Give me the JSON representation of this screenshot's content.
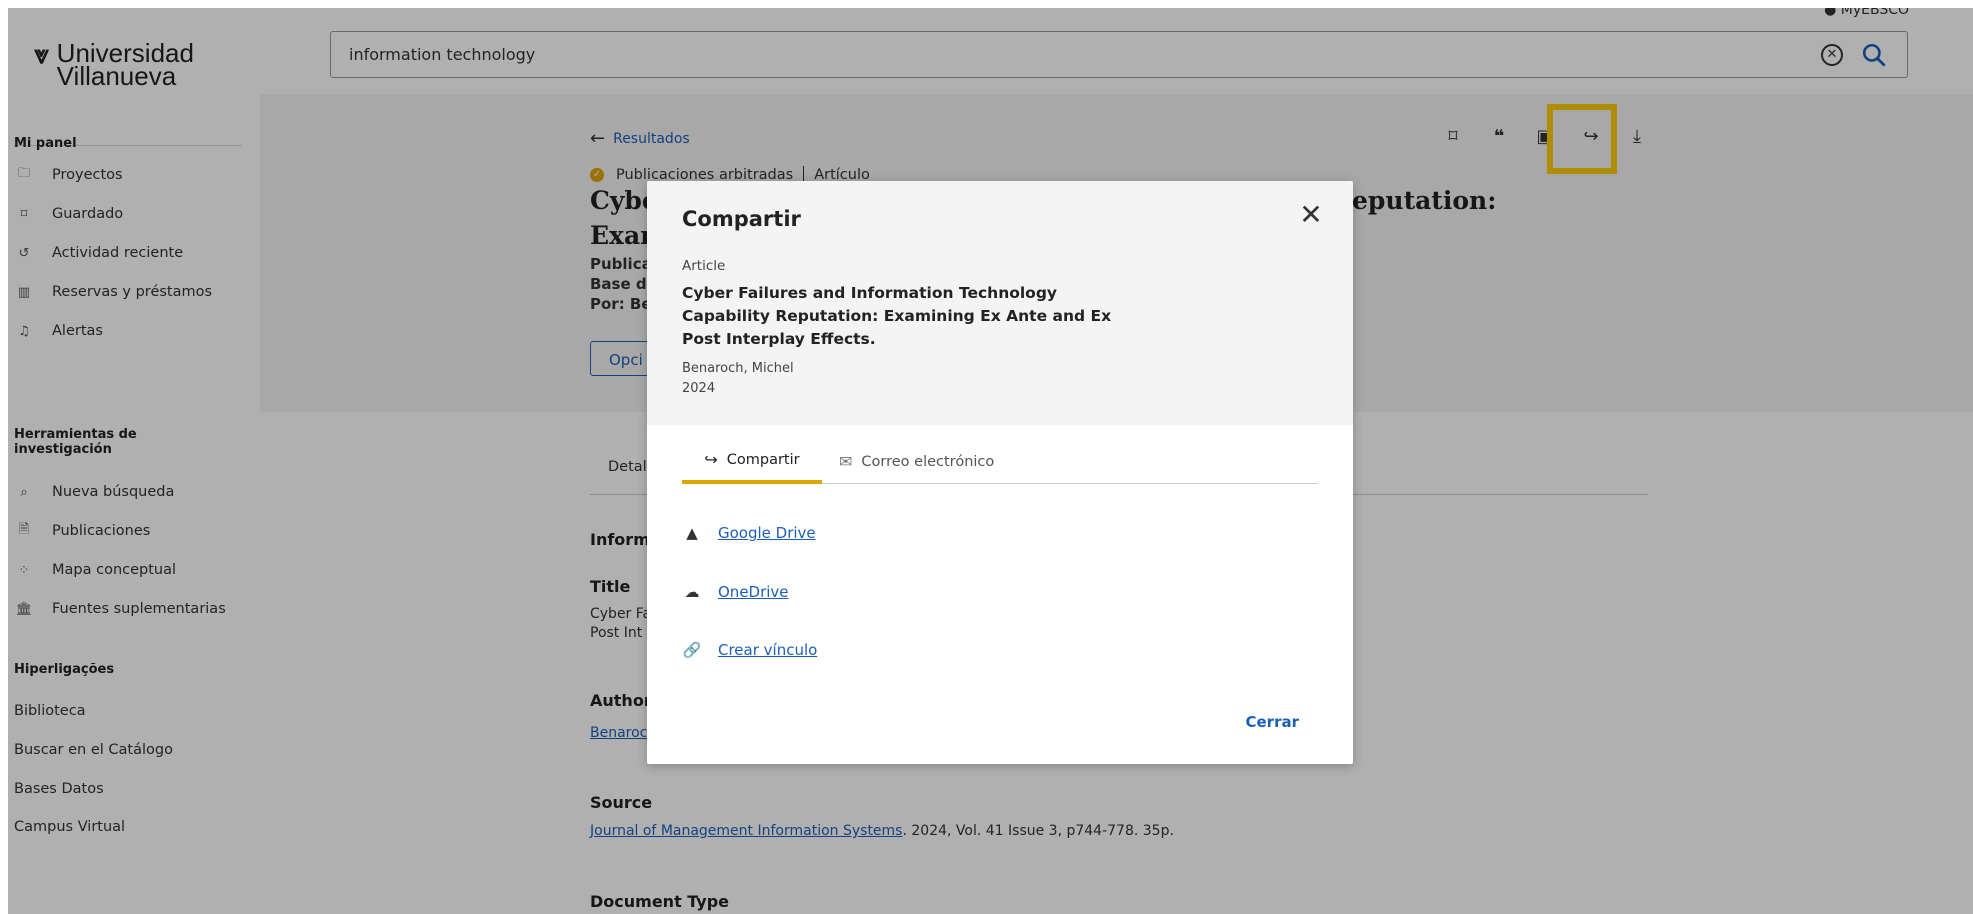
{
  "sidebar": {
    "logo_line1": "Universidad",
    "logo_line2": "Villanueva",
    "panel_heading": "Mi panel",
    "panel_items": [
      {
        "label": "Proyectos",
        "icon": "folder-icon"
      },
      {
        "label": "Guardado",
        "icon": "bookmark-icon"
      },
      {
        "label": "Actividad reciente",
        "icon": "history-icon"
      },
      {
        "label": "Reservas y préstamos",
        "icon": "books-icon"
      },
      {
        "label": "Alertas",
        "icon": "bell-icon"
      }
    ],
    "tools_heading_1": "Herramientas de",
    "tools_heading_2": "investigación",
    "tools_items": [
      {
        "label": "Nueva búsqueda",
        "icon": "search-icon"
      },
      {
        "label": "Publicaciones",
        "icon": "document-icon"
      },
      {
        "label": "Mapa conceptual",
        "icon": "concept-map-icon"
      },
      {
        "label": "Fuentes suplementarias",
        "icon": "bank-icon"
      }
    ],
    "links_heading": "Hiperligações",
    "links": [
      "Biblioteca",
      "Buscar en el Catálogo",
      "Bases Datos",
      "Campus Virtual"
    ]
  },
  "topbar": {
    "search_value": "information technology",
    "account_label": "MyEBSCO"
  },
  "page": {
    "back_label": "Resultados",
    "badge_label": "Publicaciones arbitradas",
    "doc_type": "Artículo",
    "title_line1_start": "Cybe",
    "title_line1_end": "eputation:",
    "title_line2_start": "Exar",
    "meta_1": "Publica",
    "meta_2": "Base d",
    "meta_3": "Por: Be",
    "options_label": "Opci",
    "tab_detail": "Detal",
    "info_heading": "Inform",
    "title_heading": "Title",
    "title_value_1": "Cyber Fa",
    "title_value_2": "Post Int",
    "author_heading": "Author",
    "author_value": "Benaroc",
    "source_heading": "Source",
    "source_journal": "Journal of Management Information Systems",
    "source_rest": ". 2024, Vol. 41 Issue 3, p744-778. 35p.",
    "doctype_heading": "Document Type"
  },
  "modal": {
    "title": "Compartir",
    "article_type": "Article",
    "article_title": "Cyber Failures and Information Technology Capability Reputation: Examining Ex Ante and Ex Post Interplay Effects.",
    "author": "Benaroch, Michel",
    "year": "2024",
    "tab_share": "Compartir",
    "tab_email": "Correo electrónico",
    "share_options": [
      {
        "label": "Google Drive",
        "icon": "google-drive-icon"
      },
      {
        "label": "OneDrive",
        "icon": "cloud-icon"
      },
      {
        "label": "Crear vínculo",
        "icon": "link-icon"
      }
    ],
    "close_label": "Cerrar"
  },
  "colors": {
    "accent_blue": "#1d5fb8",
    "tab_underline": "#e0a500",
    "highlight": "#ffcc00"
  }
}
